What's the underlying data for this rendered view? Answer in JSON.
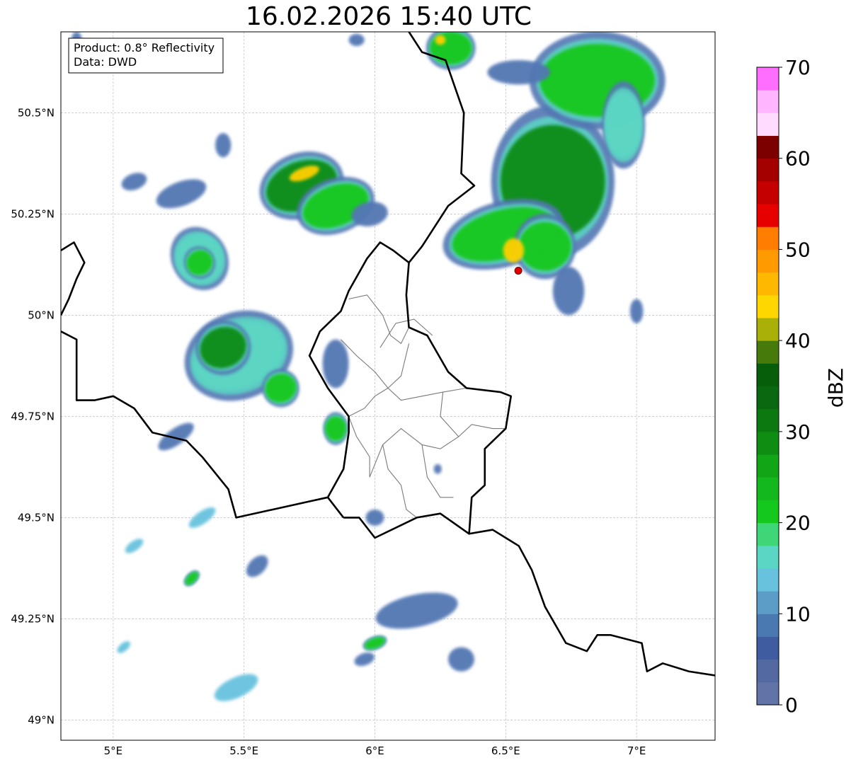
{
  "title": "16.02.2026 15:40 UTC",
  "info_box": {
    "product": "Product: 0.8° Reflectivity",
    "source": "Data: DWD"
  },
  "axes": {
    "x_ticks": [
      "5°E",
      "5.5°E",
      "6°E",
      "6.5°E",
      "7°E"
    ],
    "x_tick_values": [
      5.0,
      5.5,
      6.0,
      6.5,
      7.0
    ],
    "y_ticks": [
      "50.5°N",
      "50.25°N",
      "50°N",
      "49.75°N",
      "49.5°N",
      "49.25°N",
      "49°N"
    ],
    "y_tick_values": [
      50.5,
      50.25,
      50.0,
      49.75,
      49.5,
      49.25,
      49.0
    ],
    "lon_range": [
      4.8,
      7.3
    ],
    "lat_range": [
      48.95,
      50.7
    ],
    "grid": true
  },
  "colorbar": {
    "label": "dBZ",
    "range": [
      0,
      70
    ],
    "step": 2.5,
    "tick_labels": [
      "0",
      "10",
      "20",
      "30",
      "40",
      "50",
      "60",
      "70"
    ],
    "tick_values": [
      0,
      10,
      20,
      30,
      40,
      50,
      60,
      70
    ],
    "colors": [
      "#6273a8",
      "#5369a1",
      "#405ca0",
      "#4a78b0",
      "#5c9dc8",
      "#68c2de",
      "#5cd6c4",
      "#3fd677",
      "#14c81e",
      "#12b81c",
      "#12a617",
      "#0f8c12",
      "#0c7810",
      "#0a6910",
      "#065e0b",
      "#467b0b",
      "#a9b108",
      "#ffd700",
      "#ffb800",
      "#ff9a00",
      "#ff7d00",
      "#e60000",
      "#c50000",
      "#a50000",
      "#7d0000",
      "#ffdcff",
      "#ffb6ff",
      "#ff6eff",
      "#e636e6"
    ]
  },
  "station_marker": {
    "lon": 6.548,
    "lat": 50.11,
    "color": "#e00000"
  },
  "echo_colors": {
    "light": "#5377b3",
    "cyan": "#68c2de",
    "teal": "#5cd6c4",
    "green": "#14c81e",
    "dark_green": "#0a8c12",
    "yellow": "#ffd000"
  },
  "echo_cells": [
    {
      "lon": 5.72,
      "lat": 50.32,
      "rx": 0.14,
      "ry": 0.06,
      "rot": 20,
      "level": "dark_green"
    },
    {
      "lon": 5.85,
      "lat": 50.27,
      "rx": 0.13,
      "ry": 0.05,
      "rot": 20,
      "level": "green"
    },
    {
      "lon": 5.98,
      "lat": 50.25,
      "rx": 0.07,
      "ry": 0.03,
      "rot": 10,
      "level": "light"
    },
    {
      "lon": 5.73,
      "lat": 50.35,
      "rx": 0.06,
      "ry": 0.015,
      "rot": 20,
      "level": "yellow"
    },
    {
      "lon": 5.33,
      "lat": 50.14,
      "rx": 0.09,
      "ry": 0.06,
      "rot": 30,
      "level": "teal"
    },
    {
      "lon": 5.33,
      "lat": 50.13,
      "rx": 0.05,
      "ry": 0.03,
      "rot": 30,
      "level": "green"
    },
    {
      "lon": 5.48,
      "lat": 49.9,
      "rx": 0.18,
      "ry": 0.08,
      "rot": 20,
      "level": "teal"
    },
    {
      "lon": 5.42,
      "lat": 49.92,
      "rx": 0.09,
      "ry": 0.05,
      "rot": 20,
      "level": "dark_green"
    },
    {
      "lon": 5.64,
      "lat": 49.82,
      "rx": 0.06,
      "ry": 0.035,
      "rot": 20,
      "level": "green"
    },
    {
      "lon": 5.85,
      "lat": 49.88,
      "rx": 0.05,
      "ry": 0.06,
      "rot": 0,
      "level": "light"
    },
    {
      "lon": 5.85,
      "lat": 49.72,
      "rx": 0.04,
      "ry": 0.03,
      "rot": 0,
      "level": "green"
    },
    {
      "lon": 6.68,
      "lat": 50.33,
      "rx": 0.2,
      "ry": 0.14,
      "rot": 0,
      "level": "dark_green"
    },
    {
      "lon": 6.49,
      "lat": 50.2,
      "rx": 0.2,
      "ry": 0.06,
      "rot": 15,
      "level": "green"
    },
    {
      "lon": 6.65,
      "lat": 50.17,
      "rx": 0.1,
      "ry": 0.06,
      "rot": 0,
      "level": "green"
    },
    {
      "lon": 6.53,
      "lat": 50.16,
      "rx": 0.04,
      "ry": 0.03,
      "rot": 0,
      "level": "yellow"
    },
    {
      "lon": 6.74,
      "lat": 50.06,
      "rx": 0.06,
      "ry": 0.06,
      "rot": 0,
      "level": "light"
    },
    {
      "lon": 6.85,
      "lat": 50.58,
      "rx": 0.22,
      "ry": 0.09,
      "rot": 0,
      "level": "green"
    },
    {
      "lon": 6.95,
      "lat": 50.47,
      "rx": 0.07,
      "ry": 0.08,
      "rot": 0,
      "level": "teal"
    },
    {
      "lon": 6.55,
      "lat": 50.6,
      "rx": 0.12,
      "ry": 0.03,
      "rot": 0,
      "level": "light"
    },
    {
      "lon": 6.29,
      "lat": 50.66,
      "rx": 0.08,
      "ry": 0.04,
      "rot": 0,
      "level": "green"
    },
    {
      "lon": 6.25,
      "lat": 50.68,
      "rx": 0.02,
      "ry": 0.012,
      "rot": 0,
      "level": "yellow"
    },
    {
      "lon": 5.08,
      "lat": 50.33,
      "rx": 0.05,
      "ry": 0.02,
      "rot": 20,
      "level": "light"
    },
    {
      "lon": 5.26,
      "lat": 50.3,
      "rx": 0.1,
      "ry": 0.03,
      "rot": 20,
      "level": "light"
    },
    {
      "lon": 5.42,
      "lat": 50.42,
      "rx": 0.03,
      "ry": 0.03,
      "rot": 0,
      "level": "light"
    },
    {
      "lon": 5.24,
      "lat": 49.7,
      "rx": 0.08,
      "ry": 0.02,
      "rot": 35,
      "level": "light"
    },
    {
      "lon": 5.34,
      "lat": 49.5,
      "rx": 0.06,
      "ry": 0.015,
      "rot": 35,
      "level": "cyan"
    },
    {
      "lon": 5.08,
      "lat": 49.43,
      "rx": 0.04,
      "ry": 0.012,
      "rot": 35,
      "level": "cyan"
    },
    {
      "lon": 5.3,
      "lat": 49.35,
      "rx": 0.03,
      "ry": 0.01,
      "rot": 45,
      "level": "green"
    },
    {
      "lon": 5.55,
      "lat": 49.38,
      "rx": 0.05,
      "ry": 0.02,
      "rot": 45,
      "level": "light"
    },
    {
      "lon": 5.04,
      "lat": 49.18,
      "rx": 0.03,
      "ry": 0.01,
      "rot": 40,
      "level": "cyan"
    },
    {
      "lon": 5.47,
      "lat": 49.08,
      "rx": 0.09,
      "ry": 0.025,
      "rot": 25,
      "level": "cyan"
    },
    {
      "lon": 6.16,
      "lat": 49.27,
      "rx": 0.16,
      "ry": 0.04,
      "rot": 12,
      "level": "light"
    },
    {
      "lon": 6.33,
      "lat": 49.15,
      "rx": 0.05,
      "ry": 0.03,
      "rot": 0,
      "level": "light"
    },
    {
      "lon": 5.96,
      "lat": 49.15,
      "rx": 0.04,
      "ry": 0.015,
      "rot": 20,
      "level": "light"
    },
    {
      "lon": 6.0,
      "lat": 49.19,
      "rx": 0.04,
      "ry": 0.012,
      "rot": 20,
      "level": "green"
    },
    {
      "lon": 6.0,
      "lat": 49.5,
      "rx": 0.035,
      "ry": 0.02,
      "rot": 0,
      "level": "light"
    },
    {
      "lon": 6.24,
      "lat": 49.62,
      "rx": 0.015,
      "ry": 0.012,
      "rot": 0,
      "level": "light"
    },
    {
      "lon": 7.0,
      "lat": 50.01,
      "rx": 0.025,
      "ry": 0.03,
      "rot": 0,
      "level": "light"
    },
    {
      "lon": 4.86,
      "lat": 50.68,
      "rx": 0.02,
      "ry": 0.02,
      "rot": 0,
      "level": "light"
    },
    {
      "lon": 5.93,
      "lat": 50.68,
      "rx": 0.03,
      "ry": 0.015,
      "rot": 0,
      "level": "light"
    }
  ],
  "borders": {
    "belgium_west": [
      [
        4.8,
        50.16
      ],
      [
        4.85,
        50.18
      ],
      [
        4.89,
        50.13
      ],
      [
        4.86,
        50.09
      ],
      [
        4.83,
        50.04
      ],
      [
        4.8,
        50.0
      ]
    ],
    "belgium_france": [
      [
        4.8,
        49.96
      ],
      [
        4.86,
        49.94
      ],
      [
        4.86,
        49.79
      ],
      [
        4.93,
        49.79
      ],
      [
        5.0,
        49.8
      ],
      [
        5.08,
        49.77
      ],
      [
        5.15,
        49.71
      ],
      [
        5.28,
        49.69
      ],
      [
        5.34,
        49.65
      ],
      [
        5.44,
        49.57
      ],
      [
        5.47,
        49.5
      ],
      [
        5.61,
        49.52
      ],
      [
        5.75,
        49.54
      ],
      [
        5.82,
        49.55
      ],
      [
        5.88,
        49.5
      ]
    ],
    "lux_outer": [
      [
        5.82,
        49.55
      ],
      [
        5.88,
        49.62
      ],
      [
        5.9,
        49.71
      ],
      [
        5.9,
        49.75
      ],
      [
        5.82,
        49.82
      ],
      [
        5.75,
        49.9
      ],
      [
        5.79,
        49.96
      ],
      [
        5.87,
        50.01
      ],
      [
        5.9,
        50.06
      ],
      [
        5.97,
        50.14
      ],
      [
        6.02,
        50.18
      ],
      [
        6.07,
        50.16
      ],
      [
        6.13,
        50.13
      ],
      [
        6.12,
        50.05
      ],
      [
        6.13,
        49.97
      ],
      [
        6.2,
        49.95
      ],
      [
        6.28,
        49.86
      ],
      [
        6.35,
        49.82
      ],
      [
        6.48,
        49.81
      ],
      [
        6.52,
        49.8
      ],
      [
        6.5,
        49.72
      ],
      [
        6.42,
        49.67
      ],
      [
        6.42,
        49.58
      ],
      [
        6.37,
        49.55
      ],
      [
        6.36,
        49.46
      ],
      [
        6.25,
        49.51
      ],
      [
        6.16,
        49.5
      ],
      [
        6.0,
        49.45
      ],
      [
        5.94,
        49.5
      ],
      [
        5.88,
        49.5
      ]
    ],
    "germany_belgium": [
      [
        6.13,
        50.13
      ],
      [
        6.18,
        50.17
      ],
      [
        6.28,
        50.27
      ],
      [
        6.38,
        50.32
      ],
      [
        6.33,
        50.35
      ],
      [
        6.34,
        50.5
      ],
      [
        6.27,
        50.63
      ],
      [
        6.18,
        50.65
      ],
      [
        6.13,
        50.7
      ]
    ],
    "germany_france": [
      [
        6.36,
        49.46
      ],
      [
        6.45,
        49.47
      ],
      [
        6.55,
        49.43
      ],
      [
        6.6,
        49.37
      ],
      [
        6.65,
        49.28
      ],
      [
        6.73,
        49.19
      ],
      [
        6.81,
        49.17
      ],
      [
        6.85,
        49.21
      ],
      [
        6.9,
        49.21
      ],
      [
        7.02,
        49.19
      ],
      [
        7.04,
        49.12
      ],
      [
        7.1,
        49.14
      ],
      [
        7.2,
        49.12
      ],
      [
        7.3,
        49.11
      ]
    ]
  },
  "cantons": [
    [
      [
        5.9,
        50.04
      ],
      [
        5.97,
        50.05
      ],
      [
        6.03,
        50.0
      ],
      [
        6.06,
        49.95
      ],
      [
        6.1,
        49.93
      ],
      [
        6.13,
        49.97
      ]
    ],
    [
      [
        5.87,
        49.94
      ],
      [
        5.93,
        49.9
      ],
      [
        6.0,
        49.86
      ],
      [
        6.05,
        49.82
      ],
      [
        6.1,
        49.85
      ],
      [
        6.13,
        49.93
      ]
    ],
    [
      [
        6.02,
        49.92
      ],
      [
        6.08,
        49.98
      ],
      [
        6.15,
        49.99
      ],
      [
        6.22,
        49.95
      ]
    ],
    [
      [
        5.9,
        49.75
      ],
      [
        5.96,
        49.77
      ],
      [
        6.0,
        49.8
      ],
      [
        6.05,
        49.82
      ],
      [
        6.1,
        49.79
      ],
      [
        6.18,
        49.8
      ],
      [
        6.26,
        49.81
      ],
      [
        6.35,
        49.82
      ]
    ],
    [
      [
        6.26,
        49.81
      ],
      [
        6.25,
        49.75
      ],
      [
        6.32,
        49.7
      ],
      [
        6.37,
        49.73
      ],
      [
        6.45,
        49.72
      ],
      [
        6.5,
        49.72
      ]
    ],
    [
      [
        5.98,
        49.6
      ],
      [
        6.03,
        49.68
      ],
      [
        6.1,
        49.72
      ],
      [
        6.18,
        49.68
      ],
      [
        6.25,
        49.67
      ],
      [
        6.32,
        49.7
      ]
    ],
    [
      [
        6.03,
        49.68
      ],
      [
        6.05,
        49.62
      ],
      [
        6.1,
        49.58
      ],
      [
        6.12,
        49.52
      ],
      [
        6.16,
        49.5
      ]
    ],
    [
      [
        6.18,
        49.68
      ],
      [
        6.2,
        49.6
      ],
      [
        6.25,
        49.55
      ],
      [
        6.3,
        49.55
      ]
    ],
    [
      [
        5.9,
        49.75
      ],
      [
        5.93,
        49.7
      ],
      [
        5.98,
        49.65
      ],
      [
        5.98,
        49.6
      ]
    ]
  ]
}
